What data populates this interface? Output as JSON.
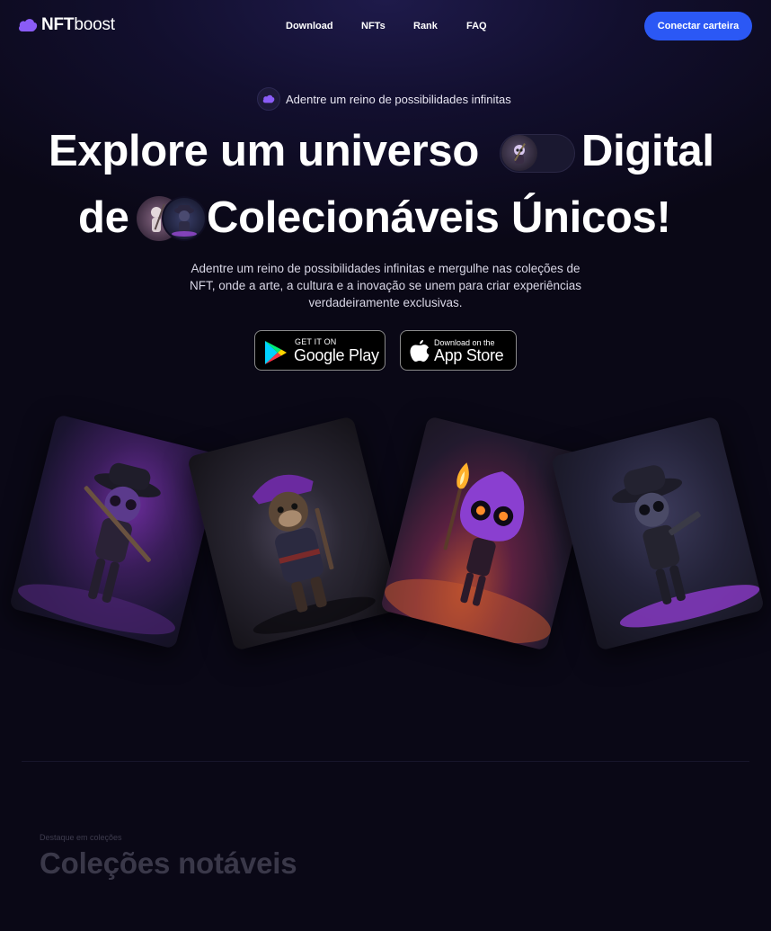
{
  "brand": {
    "name_bold": "NFT",
    "name_light": "boost",
    "logo_icon": "cloud-logo-icon",
    "accent": "#7c5cff"
  },
  "nav": {
    "links": [
      "Download",
      "NFTs",
      "Rank",
      "FAQ"
    ],
    "cta": "Conectar carteira",
    "cta_color": "#2b58f5"
  },
  "hero": {
    "badge": "Adentre um reino de possibilidades infinitas",
    "headline_line1_a": "Explore um universo",
    "headline_line1_b": "Digital",
    "headline_line2_a": "de",
    "headline_line2_b": "Colecionáveis Únicos!",
    "description": "Adentre um reino de possibilidades infinitas e mergulhe nas coleções de NFT, onde a arte, a cultura e a inovação se unem para criar experiências verdadeiramente exclusivas."
  },
  "stores": {
    "google": {
      "small": "GET IT ON",
      "big": "Google Play",
      "icon": "google-play-icon"
    },
    "apple": {
      "small": "Download on the",
      "big": "App Store",
      "icon": "apple-icon"
    }
  },
  "cards": [
    {
      "name": "nft-card-purple-skeleton-pirate"
    },
    {
      "name": "nft-card-monkey-pirate"
    },
    {
      "name": "nft-card-torch-creature"
    },
    {
      "name": "nft-card-skeleton-gunslinger"
    }
  ],
  "collections": {
    "eyebrow": "Destaque em coleções",
    "title": "Coleções notáveis"
  }
}
